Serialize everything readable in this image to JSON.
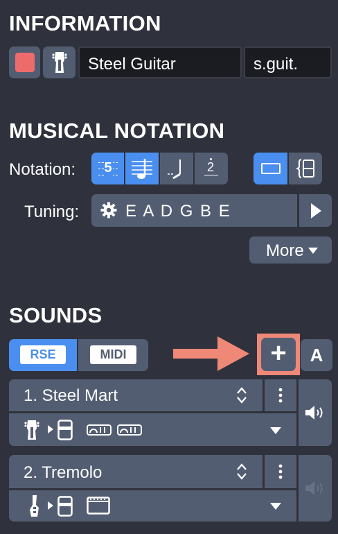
{
  "information": {
    "heading": "INFORMATION",
    "color_swatch": "#ee6b6b",
    "instrument_icon": "acoustic-guitar-icon",
    "name_value": "Steel Guitar",
    "short_name_value": "s.guit."
  },
  "notation": {
    "heading": "MUSICAL NOTATION",
    "notation_label": "Notation:",
    "tab_digit": "5",
    "numeric_digit": "2",
    "tuning_label": "Tuning:",
    "tuning_value": "E A D G B E",
    "more_label": "More"
  },
  "sounds": {
    "heading": "SOUNDS",
    "rse_label": "RSE",
    "midi_label": "MIDI",
    "add_label": "+",
    "auto_label": "A",
    "items": [
      {
        "name": "1. Steel Mart",
        "active": true
      },
      {
        "name": "2. Tremolo",
        "active": false
      }
    ]
  },
  "colors": {
    "background": "#2f323c",
    "button": "#535d72",
    "accent_blue": "#4a8ff0",
    "highlight": "#f08878"
  }
}
